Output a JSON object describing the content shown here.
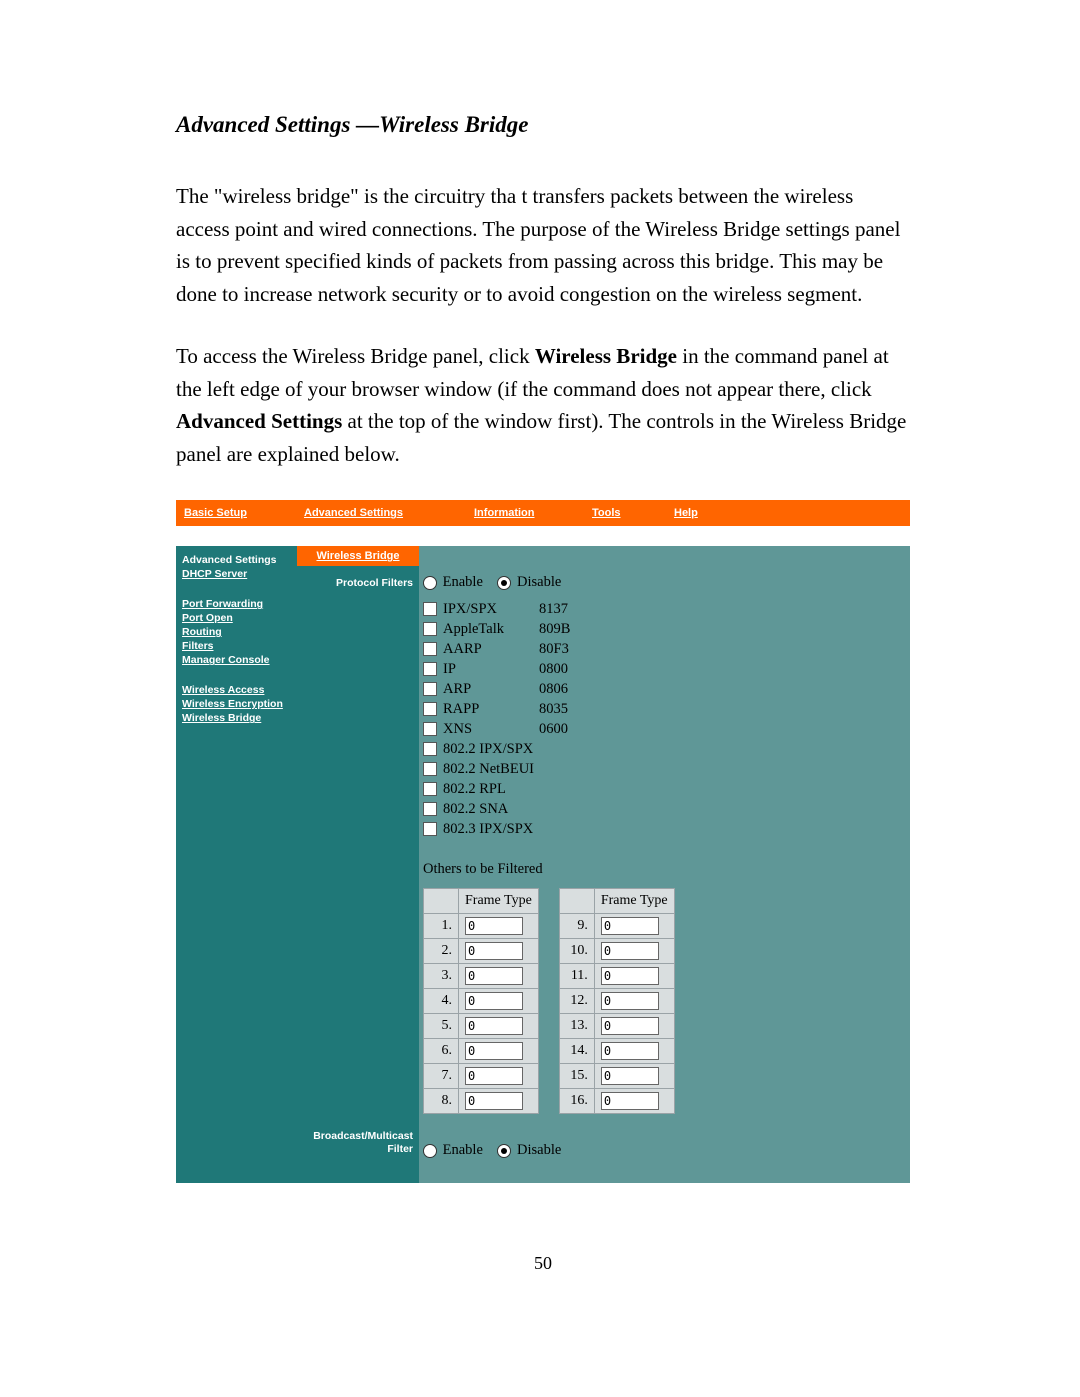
{
  "heading": "Advanced Settings —Wireless Bridge",
  "para1": "The \"wireless bridge\" is the circuitry tha t transfers packets between the wireless access point and wired connections. The purpose of the Wireless Bridge settings panel is to prevent specified kinds of packets from passing across this bridge. This may be done to increase network security or to avoid congestion on the wireless segment.",
  "para2_a": "To access the Wireless Bridge panel, click ",
  "para2_b_bold": "Wireless Bridge",
  "para2_c": " in the command panel at the left edge of your browser window (if the command does not appear there, click ",
  "para2_d_bold": "Advanced Settings",
  "para2_e": " at the top of the window first). The controls in the Wireless Bridge panel are explained below.",
  "page_number": "50",
  "topnav": {
    "basic": "Basic Setup",
    "advanced": "Advanced Settings",
    "information": "Information",
    "tools": "Tools",
    "help": "Help"
  },
  "sidebar": {
    "title": "Advanced Settings",
    "links": [
      "DHCP Server",
      "",
      "Port Forwarding",
      "Port Open",
      "Routing",
      "Filters",
      "Manager Console",
      "",
      "Wireless Access",
      "Wireless Encryption",
      "Wireless Bridge"
    ]
  },
  "panel": {
    "title": "Wireless Bridge",
    "protocol_filters_label": "Protocol Filters",
    "broadcast_label": "Broadcast/Multicast Filter",
    "enable": "Enable",
    "disable": "Disable",
    "protocols": [
      {
        "name": "IPX/SPX",
        "hex": "8137"
      },
      {
        "name": "AppleTalk",
        "hex": "809B"
      },
      {
        "name": "AARP",
        "hex": "80F3"
      },
      {
        "name": "IP",
        "hex": "0800"
      },
      {
        "name": "ARP",
        "hex": "0806"
      },
      {
        "name": "RAPP",
        "hex": "8035"
      },
      {
        "name": "XNS",
        "hex": "0600"
      },
      {
        "name": "802.2 IPX/SPX",
        "hex": ""
      },
      {
        "name": "802.2 NetBEUI",
        "hex": ""
      },
      {
        "name": "802.2 RPL",
        "hex": ""
      },
      {
        "name": "802.2 SNA",
        "hex": ""
      },
      {
        "name": "802.3 IPX/SPX",
        "hex": ""
      }
    ],
    "others_label": "Others to be Filtered",
    "frame_type_header": "Frame Type",
    "left_rows": [
      {
        "n": "1.",
        "v": "0"
      },
      {
        "n": "2.",
        "v": "0"
      },
      {
        "n": "3.",
        "v": "0"
      },
      {
        "n": "4.",
        "v": "0"
      },
      {
        "n": "5.",
        "v": "0"
      },
      {
        "n": "6.",
        "v": "0"
      },
      {
        "n": "7.",
        "v": "0"
      },
      {
        "n": "8.",
        "v": "0"
      }
    ],
    "right_rows": [
      {
        "n": "9.",
        "v": "0"
      },
      {
        "n": "10.",
        "v": "0"
      },
      {
        "n": "11.",
        "v": "0"
      },
      {
        "n": "12.",
        "v": "0"
      },
      {
        "n": "13.",
        "v": "0"
      },
      {
        "n": "14.",
        "v": "0"
      },
      {
        "n": "15.",
        "v": "0"
      },
      {
        "n": "16.",
        "v": "0"
      }
    ]
  }
}
